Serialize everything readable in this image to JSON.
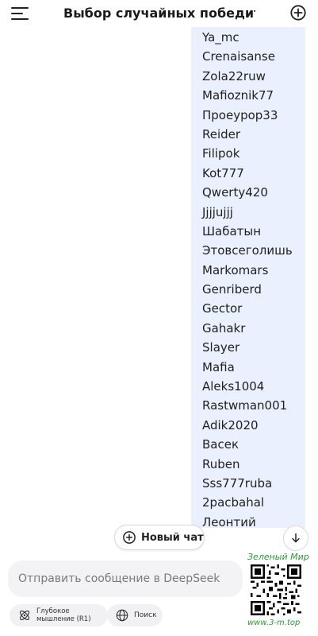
{
  "header": {
    "title": "Выбор случайных победит...",
    "menu_icon": "hamburger-menu-icon",
    "new_chat_icon": "plus-circle-icon"
  },
  "message": {
    "names": [
      "Ya_mc",
      "Crenaisanse",
      "Zola22ruw",
      "Mafioznik77",
      "Проеурор33",
      "Reider",
      "Filipok",
      "Kot777",
      "Qwerty420",
      "Jjjjujjj",
      "Шабатын",
      "Этовсеголишь",
      "Markomars",
      "Genriberd",
      "Gector",
      "Gahakr",
      "Slayer",
      "Mafia",
      "Aleks1004",
      "Rastwman001",
      "Adik2020",
      "Васек",
      "Ruben",
      "Sss777ruba",
      "2pacbahal",
      "Леонтий"
    ]
  },
  "new_chat_button": {
    "label": "Новый чат",
    "icon": "plus-circle-icon"
  },
  "scroll_down_icon": "arrow-down-icon",
  "composer": {
    "placeholder": "Отправить сообщение в DeepSeek",
    "value": ""
  },
  "chips": {
    "deep_thinking": {
      "label_line1": "Глубокое",
      "label_line2": "мышление (R1)",
      "icon": "atom-icon"
    },
    "search": {
      "label": "Поиск",
      "icon": "globe-icon"
    }
  },
  "watermark": {
    "brand": "Зеленый Мир",
    "url": "www.3-m.top",
    "color": "#2e9b3a"
  },
  "colors": {
    "bubble_bg": "#eaf0fd",
    "composer_bg": "#f3f3f5"
  }
}
